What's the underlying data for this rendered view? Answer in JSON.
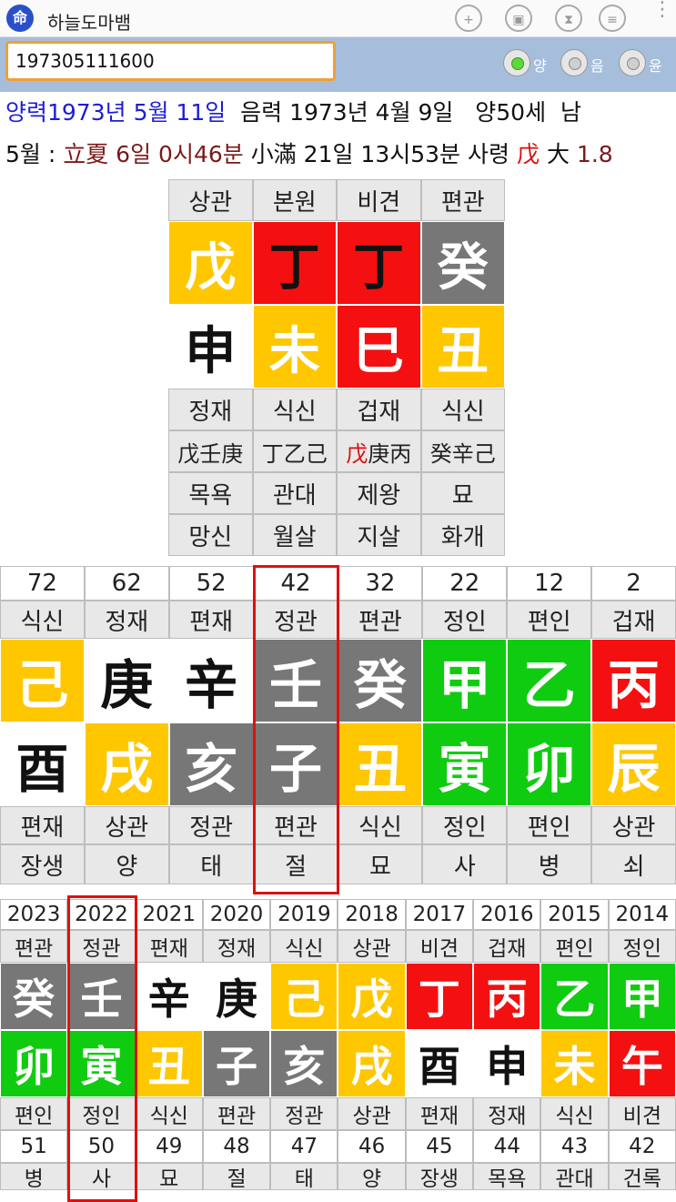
{
  "app": {
    "title": "하늘도마뱀",
    "icon_text": "命"
  },
  "toolbar": {
    "icons": [
      "add-user-icon",
      "save-icon",
      "hourglass-icon",
      "database-icon",
      "more-icon"
    ]
  },
  "input": {
    "value": "197305111600"
  },
  "radios": [
    {
      "label": "양",
      "selected": true
    },
    {
      "label": "음",
      "selected": false
    },
    {
      "label": "윤",
      "selected": false
    }
  ],
  "info": {
    "solar": "양력1973년 5월 11일",
    "lunar": "음력 1973년 4월 9일",
    "age": "양50세",
    "gender": "남",
    "month_prefix": "5월 :",
    "term1": "立夏 6일 0시46분",
    "term2": "小滿 21일 13시53분",
    "saryeong_label": "사령",
    "saryeong_char": "戊",
    "daeun_label": "大",
    "daeun_value": "1.8"
  },
  "palette": {
    "white": "#ffffff",
    "yellow": "#ffc700",
    "red": "#f41010",
    "gray": "#777777",
    "green": "#10cc10",
    "highlight": "#e01010"
  },
  "saju": {
    "headers": [
      "상관",
      "본원",
      "비견",
      "편관"
    ],
    "stems": [
      {
        "char": "戊",
        "bg": "yellow",
        "fg": "white"
      },
      {
        "char": "丁",
        "bg": "red",
        "fg": "black"
      },
      {
        "char": "丁",
        "bg": "red",
        "fg": "black"
      },
      {
        "char": "癸",
        "bg": "gray",
        "fg": "white"
      }
    ],
    "branches": [
      {
        "char": "申",
        "bg": "white",
        "fg": "black"
      },
      {
        "char": "未",
        "bg": "yellow",
        "fg": "white"
      },
      {
        "char": "巳",
        "bg": "red",
        "fg": "white"
      },
      {
        "char": "丑",
        "bg": "yellow",
        "fg": "white"
      }
    ],
    "branch_gods": [
      "정재",
      "식신",
      "겁재",
      "식신"
    ],
    "hidden_stems": [
      [
        {
          "t": "戊壬庚",
          "red": false
        }
      ],
      [
        {
          "t": "丁乙己",
          "red": false
        }
      ],
      [
        {
          "t": "戊",
          "red": true
        },
        {
          "t": "庚丙",
          "red": false
        }
      ],
      [
        {
          "t": "癸辛己",
          "red": false
        }
      ]
    ],
    "stages": [
      "목욕",
      "관대",
      "제왕",
      "묘"
    ],
    "spirits": [
      "망신",
      "월살",
      "지살",
      "화개"
    ]
  },
  "daeun": {
    "ages": [
      "72",
      "62",
      "52",
      "42",
      "32",
      "22",
      "12",
      "2"
    ],
    "stem_gods": [
      "식신",
      "정재",
      "편재",
      "정관",
      "편관",
      "정인",
      "편인",
      "겁재"
    ],
    "stems": [
      {
        "char": "己",
        "bg": "yellow",
        "fg": "white"
      },
      {
        "char": "庚",
        "bg": "white",
        "fg": "black"
      },
      {
        "char": "辛",
        "bg": "white",
        "fg": "black"
      },
      {
        "char": "壬",
        "bg": "gray",
        "fg": "white"
      },
      {
        "char": "癸",
        "bg": "gray",
        "fg": "white"
      },
      {
        "char": "甲",
        "bg": "green",
        "fg": "white"
      },
      {
        "char": "乙",
        "bg": "green",
        "fg": "white"
      },
      {
        "char": "丙",
        "bg": "red",
        "fg": "white"
      }
    ],
    "branches": [
      {
        "char": "酉",
        "bg": "white",
        "fg": "black"
      },
      {
        "char": "戌",
        "bg": "yellow",
        "fg": "white"
      },
      {
        "char": "亥",
        "bg": "gray",
        "fg": "white"
      },
      {
        "char": "子",
        "bg": "gray",
        "fg": "white"
      },
      {
        "char": "丑",
        "bg": "yellow",
        "fg": "white"
      },
      {
        "char": "寅",
        "bg": "green",
        "fg": "white"
      },
      {
        "char": "卯",
        "bg": "green",
        "fg": "white"
      },
      {
        "char": "辰",
        "bg": "yellow",
        "fg": "white"
      }
    ],
    "branch_gods": [
      "편재",
      "상관",
      "정관",
      "편관",
      "식신",
      "정인",
      "편인",
      "상관"
    ],
    "stages": [
      "장생",
      "양",
      "태",
      "절",
      "묘",
      "사",
      "병",
      "쇠"
    ],
    "current_index": 3
  },
  "yearly": {
    "years": [
      "2023",
      "2022",
      "2021",
      "2020",
      "2019",
      "2018",
      "2017",
      "2016",
      "2015",
      "2014"
    ],
    "stem_gods": [
      "편관",
      "정관",
      "편재",
      "정재",
      "식신",
      "상관",
      "비견",
      "겁재",
      "편인",
      "정인"
    ],
    "stems": [
      {
        "char": "癸",
        "bg": "gray",
        "fg": "white"
      },
      {
        "char": "壬",
        "bg": "gray",
        "fg": "white"
      },
      {
        "char": "辛",
        "bg": "white",
        "fg": "black"
      },
      {
        "char": "庚",
        "bg": "white",
        "fg": "black"
      },
      {
        "char": "己",
        "bg": "yellow",
        "fg": "white"
      },
      {
        "char": "戊",
        "bg": "yellow",
        "fg": "white"
      },
      {
        "char": "丁",
        "bg": "red",
        "fg": "white"
      },
      {
        "char": "丙",
        "bg": "red",
        "fg": "white"
      },
      {
        "char": "乙",
        "bg": "green",
        "fg": "white"
      },
      {
        "char": "甲",
        "bg": "green",
        "fg": "white"
      }
    ],
    "branches": [
      {
        "char": "卯",
        "bg": "green",
        "fg": "white"
      },
      {
        "char": "寅",
        "bg": "green",
        "fg": "white"
      },
      {
        "char": "丑",
        "bg": "yellow",
        "fg": "white"
      },
      {
        "char": "子",
        "bg": "gray",
        "fg": "white"
      },
      {
        "char": "亥",
        "bg": "gray",
        "fg": "white"
      },
      {
        "char": "戌",
        "bg": "yellow",
        "fg": "white"
      },
      {
        "char": "酉",
        "bg": "white",
        "fg": "black"
      },
      {
        "char": "申",
        "bg": "white",
        "fg": "black"
      },
      {
        "char": "未",
        "bg": "yellow",
        "fg": "white"
      },
      {
        "char": "午",
        "bg": "red",
        "fg": "white"
      }
    ],
    "branch_gods": [
      "편인",
      "정인",
      "식신",
      "편관",
      "정관",
      "상관",
      "편재",
      "정재",
      "식신",
      "비견"
    ],
    "ages": [
      "51",
      "50",
      "49",
      "48",
      "47",
      "46",
      "45",
      "44",
      "43",
      "42"
    ],
    "stages": [
      "병",
      "사",
      "묘",
      "절",
      "태",
      "양",
      "장생",
      "목욕",
      "관대",
      "건록"
    ],
    "current_index": 1
  }
}
